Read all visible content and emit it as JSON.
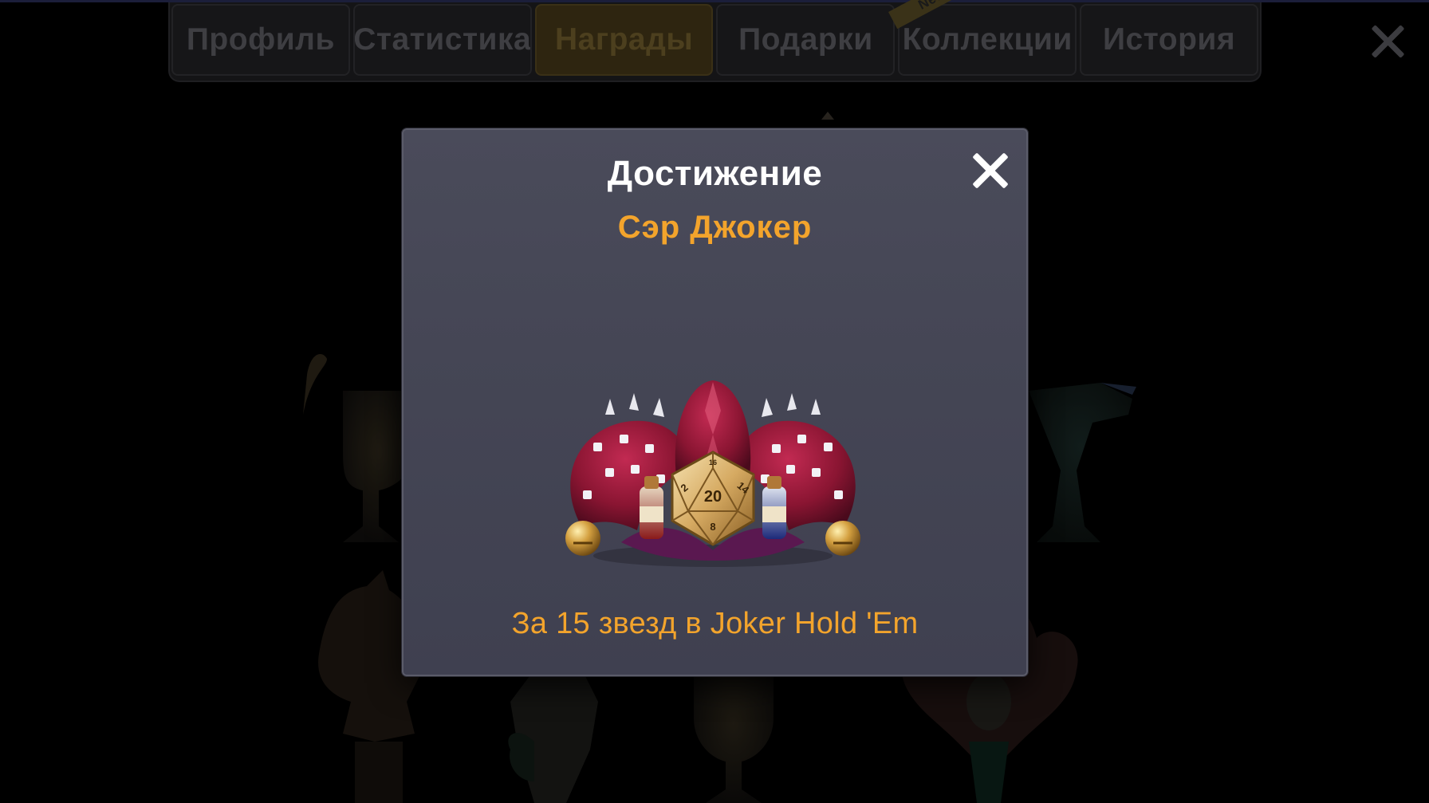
{
  "tabs": [
    {
      "label": "Профиль",
      "active": false
    },
    {
      "label": "Статистика",
      "active": false
    },
    {
      "label": "Награды",
      "active": true
    },
    {
      "label": "Подарки",
      "active": false
    },
    {
      "label": "Коллекции",
      "active": false,
      "badge": "New"
    },
    {
      "label": "История",
      "active": false
    }
  ],
  "dialog": {
    "title": "Достижение",
    "award_name": "Сэр Джокер",
    "description": "За 15 звезд в Joker Hold 'Em",
    "image_icon": "jester-hat-d20-icon",
    "die_numbers": [
      "20",
      "2",
      "14",
      "8",
      "16"
    ]
  },
  "colors": {
    "accent": "#f3a42c",
    "dialog_bg": "#464756",
    "active_tab_bg": "#2e2510",
    "tab_text": "#3e3e42"
  }
}
